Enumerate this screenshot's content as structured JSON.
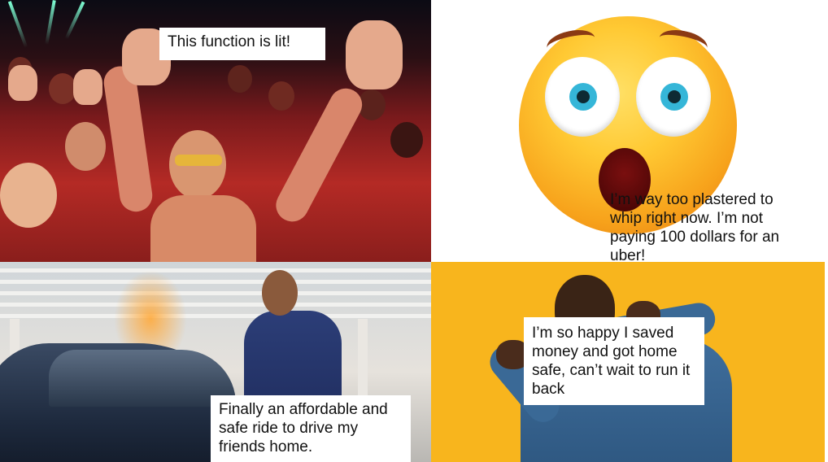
{
  "panels": [
    {
      "caption": "This function is lit!"
    },
    {
      "caption": "I’m way too plastered to whip right now. I’m not paying 100 dollars for an uber!"
    },
    {
      "caption": "Finally an affordable and safe ride to drive my friends home."
    },
    {
      "caption": "I’m so happy I saved money and got home safe, can’t wait to run it back"
    }
  ],
  "colors": {
    "party_red": "#b42a25",
    "emoji_yellow": "#ffc933",
    "panel4_yellow": "#f8b51d",
    "suit_blue": "#2c3e78"
  },
  "icons": [
    "crowd-photo",
    "shocked-face-emoji",
    "car-photo",
    "happy-man-photo"
  ]
}
